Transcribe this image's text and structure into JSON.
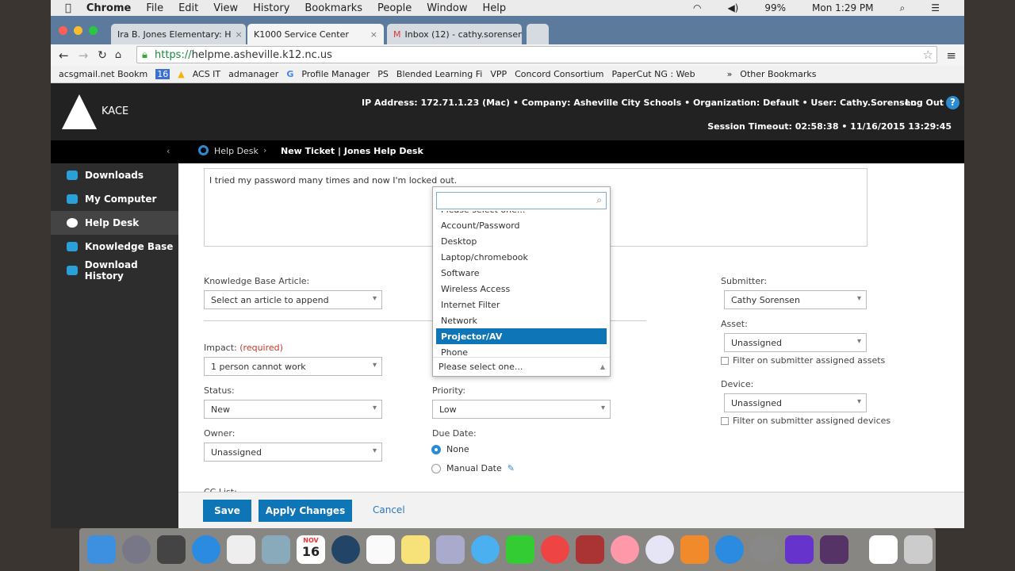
{
  "menubar": {
    "app": "Chrome",
    "items": [
      "File",
      "Edit",
      "View",
      "History",
      "Bookmarks",
      "People",
      "Window",
      "Help"
    ],
    "battery": "99%",
    "clock": "Mon 1:29 PM"
  },
  "tabs": [
    {
      "title": "Ira B. Jones Elementary: H"
    },
    {
      "title": "K1000 Service Center"
    },
    {
      "title": "Inbox (12) - cathy.sorensen"
    }
  ],
  "address": {
    "scheme": "https://",
    "host": "helpme.asheville.k12.nc.us"
  },
  "bookmarks": [
    "acsgmail.net Bookm",
    "16",
    "ACS IT",
    "admanager",
    "Profile Manager",
    "PS",
    "Blended Learning Fi",
    "VPP",
    "Concord Consortium",
    "PaperCut NG : Web",
    "»",
    "Other Bookmarks"
  ],
  "header": {
    "logo": "KACE",
    "info": "IP Address: 172.71.1.23 (Mac) • Company: Asheville City Schools • Organization: Default • User: Cathy.Sorensen",
    "logout": "Log Out",
    "session": "Session Timeout: 02:58:38 • 11/16/2015 13:29:45"
  },
  "breadcrumb": {
    "root": "Help Desk",
    "current": "New Ticket | Jones Help Desk"
  },
  "sidebar": {
    "items": [
      {
        "label": "Downloads"
      },
      {
        "label": "My Computer"
      },
      {
        "label": "Help Desk",
        "active": true
      },
      {
        "label": "Knowledge Base"
      },
      {
        "label": "Download History"
      }
    ]
  },
  "form": {
    "description": "I tried my password many times and now I'm locked out.",
    "kb_label": "Knowledge Base Article:",
    "kb_value": "Select an article to append",
    "impact_label": "Impact:",
    "impact_required": "(required)",
    "impact_value": "1 person cannot work",
    "status_label": "Status:",
    "status_value": "New",
    "owner_label": "Owner:",
    "owner_value": "Unassigned",
    "priority_label": "Priority:",
    "priority_value": "Low",
    "due_label": "Due Date:",
    "due_none": "None",
    "due_manual": "Manual Date",
    "due_selected": "None",
    "cc_label": "CC List:",
    "category_value": "Please select one...",
    "category_options": [
      "Please select one...",
      "Account/Password",
      "Desktop",
      "Laptop/chromebook",
      "Software",
      "Wireless Access",
      "Internet Filter",
      "Network",
      "Projector/AV",
      "Phone"
    ],
    "category_highlighted": "Projector/AV",
    "submitter_label": "Submitter:",
    "submitter_value": "Cathy Sorensen",
    "asset_label": "Asset:",
    "asset_value": "Unassigned",
    "asset_filter": "Filter on submitter assigned assets",
    "device_label": "Device:",
    "device_value": "Unassigned",
    "device_filter": "Filter on submitter assigned devices"
  },
  "footer": {
    "save": "Save",
    "apply": "Apply Changes",
    "cancel": "Cancel"
  },
  "dock": {
    "calendar_day": "16",
    "calendar_month": "NOV"
  },
  "colors": {
    "accent": "#0e75b6",
    "sidebar": "#2d2d2d",
    "header": "#222222",
    "required": "#c0392b"
  }
}
